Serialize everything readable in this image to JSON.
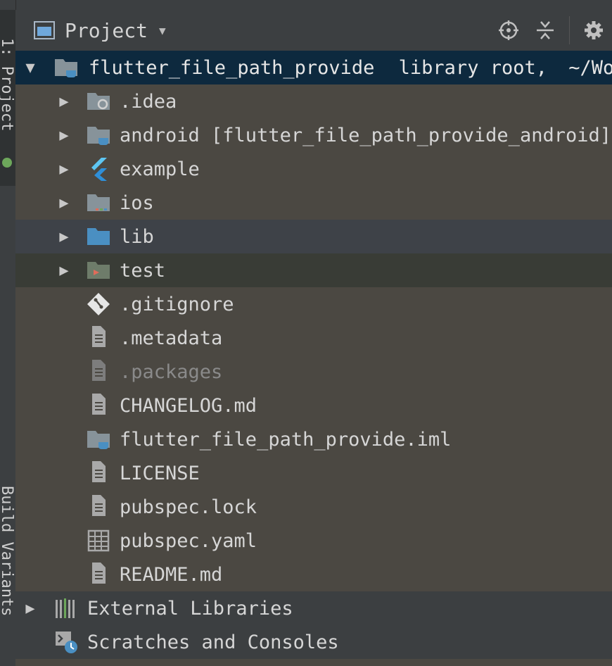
{
  "side_tabs": {
    "project": "1: Project",
    "build_variants": "Build Variants"
  },
  "panel": {
    "title": "Project"
  },
  "tree": {
    "root": {
      "name": "flutter_file_path_provide",
      "annotation": "library root,",
      "path": "~/Wor"
    },
    "items": [
      {
        "name": ".idea",
        "icon": "settings-folder-icon",
        "expandable": true
      },
      {
        "name": "android [flutter_file_path_provide_android]",
        "icon": "module-folder-icon",
        "expandable": true
      },
      {
        "name": "example",
        "icon": "flutter-icon",
        "expandable": true
      },
      {
        "name": "ios",
        "icon": "ios-folder-icon",
        "expandable": true
      },
      {
        "name": "lib",
        "icon": "source-folder-icon",
        "expandable": true
      },
      {
        "name": "test",
        "icon": "test-folder-icon",
        "expandable": true
      },
      {
        "name": ".gitignore",
        "icon": "git-icon",
        "expandable": false
      },
      {
        "name": ".metadata",
        "icon": "file-icon",
        "expandable": false
      },
      {
        "name": ".packages",
        "icon": "file-icon",
        "expandable": false
      },
      {
        "name": "CHANGELOG.md",
        "icon": "file-icon",
        "expandable": false
      },
      {
        "name": "flutter_file_path_provide.iml",
        "icon": "module-file-icon",
        "expandable": false
      },
      {
        "name": "LICENSE",
        "icon": "file-icon",
        "expandable": false
      },
      {
        "name": "pubspec.lock",
        "icon": "file-icon",
        "expandable": false
      },
      {
        "name": "pubspec.yaml",
        "icon": "yaml-icon",
        "expandable": false
      },
      {
        "name": "README.md",
        "icon": "file-icon",
        "expandable": false
      }
    ],
    "external_libraries": "External Libraries",
    "scratches": "Scratches and Consoles"
  },
  "colors": {
    "selection": "#0d293e",
    "tree_bg": "#4b4842",
    "folder": "#87939a",
    "source_folder": "#4a8fc2"
  }
}
